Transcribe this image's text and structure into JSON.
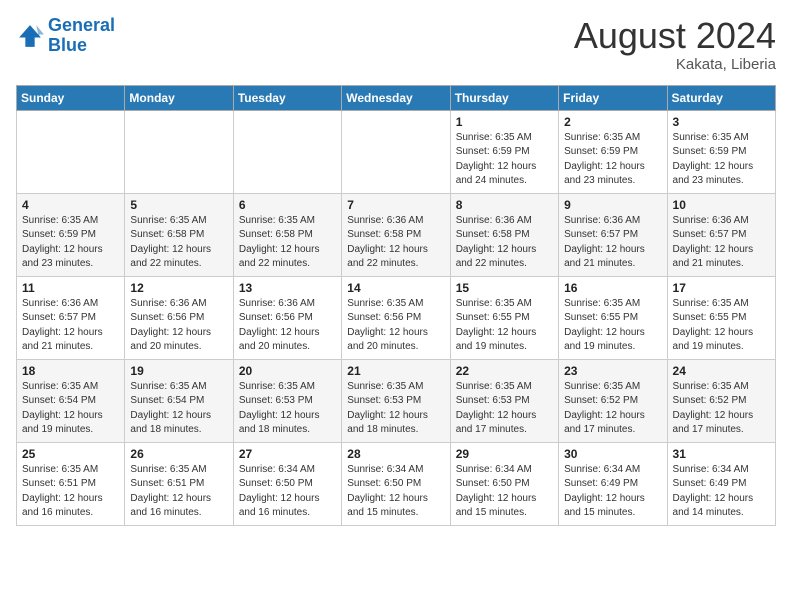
{
  "logo": {
    "line1": "General",
    "line2": "Blue"
  },
  "title": "August 2024",
  "location": "Kakata, Liberia",
  "weekdays": [
    "Sunday",
    "Monday",
    "Tuesday",
    "Wednesday",
    "Thursday",
    "Friday",
    "Saturday"
  ],
  "weeks": [
    [
      {
        "day": "",
        "detail": ""
      },
      {
        "day": "",
        "detail": ""
      },
      {
        "day": "",
        "detail": ""
      },
      {
        "day": "",
        "detail": ""
      },
      {
        "day": "1",
        "detail": "Sunrise: 6:35 AM\nSunset: 6:59 PM\nDaylight: 12 hours\nand 24 minutes."
      },
      {
        "day": "2",
        "detail": "Sunrise: 6:35 AM\nSunset: 6:59 PM\nDaylight: 12 hours\nand 23 minutes."
      },
      {
        "day": "3",
        "detail": "Sunrise: 6:35 AM\nSunset: 6:59 PM\nDaylight: 12 hours\nand 23 minutes."
      }
    ],
    [
      {
        "day": "4",
        "detail": "Sunrise: 6:35 AM\nSunset: 6:59 PM\nDaylight: 12 hours\nand 23 minutes."
      },
      {
        "day": "5",
        "detail": "Sunrise: 6:35 AM\nSunset: 6:58 PM\nDaylight: 12 hours\nand 22 minutes."
      },
      {
        "day": "6",
        "detail": "Sunrise: 6:35 AM\nSunset: 6:58 PM\nDaylight: 12 hours\nand 22 minutes."
      },
      {
        "day": "7",
        "detail": "Sunrise: 6:36 AM\nSunset: 6:58 PM\nDaylight: 12 hours\nand 22 minutes."
      },
      {
        "day": "8",
        "detail": "Sunrise: 6:36 AM\nSunset: 6:58 PM\nDaylight: 12 hours\nand 22 minutes."
      },
      {
        "day": "9",
        "detail": "Sunrise: 6:36 AM\nSunset: 6:57 PM\nDaylight: 12 hours\nand 21 minutes."
      },
      {
        "day": "10",
        "detail": "Sunrise: 6:36 AM\nSunset: 6:57 PM\nDaylight: 12 hours\nand 21 minutes."
      }
    ],
    [
      {
        "day": "11",
        "detail": "Sunrise: 6:36 AM\nSunset: 6:57 PM\nDaylight: 12 hours\nand 21 minutes."
      },
      {
        "day": "12",
        "detail": "Sunrise: 6:36 AM\nSunset: 6:56 PM\nDaylight: 12 hours\nand 20 minutes."
      },
      {
        "day": "13",
        "detail": "Sunrise: 6:36 AM\nSunset: 6:56 PM\nDaylight: 12 hours\nand 20 minutes."
      },
      {
        "day": "14",
        "detail": "Sunrise: 6:35 AM\nSunset: 6:56 PM\nDaylight: 12 hours\nand 20 minutes."
      },
      {
        "day": "15",
        "detail": "Sunrise: 6:35 AM\nSunset: 6:55 PM\nDaylight: 12 hours\nand 19 minutes."
      },
      {
        "day": "16",
        "detail": "Sunrise: 6:35 AM\nSunset: 6:55 PM\nDaylight: 12 hours\nand 19 minutes."
      },
      {
        "day": "17",
        "detail": "Sunrise: 6:35 AM\nSunset: 6:55 PM\nDaylight: 12 hours\nand 19 minutes."
      }
    ],
    [
      {
        "day": "18",
        "detail": "Sunrise: 6:35 AM\nSunset: 6:54 PM\nDaylight: 12 hours\nand 19 minutes."
      },
      {
        "day": "19",
        "detail": "Sunrise: 6:35 AM\nSunset: 6:54 PM\nDaylight: 12 hours\nand 18 minutes."
      },
      {
        "day": "20",
        "detail": "Sunrise: 6:35 AM\nSunset: 6:53 PM\nDaylight: 12 hours\nand 18 minutes."
      },
      {
        "day": "21",
        "detail": "Sunrise: 6:35 AM\nSunset: 6:53 PM\nDaylight: 12 hours\nand 18 minutes."
      },
      {
        "day": "22",
        "detail": "Sunrise: 6:35 AM\nSunset: 6:53 PM\nDaylight: 12 hours\nand 17 minutes."
      },
      {
        "day": "23",
        "detail": "Sunrise: 6:35 AM\nSunset: 6:52 PM\nDaylight: 12 hours\nand 17 minutes."
      },
      {
        "day": "24",
        "detail": "Sunrise: 6:35 AM\nSunset: 6:52 PM\nDaylight: 12 hours\nand 17 minutes."
      }
    ],
    [
      {
        "day": "25",
        "detail": "Sunrise: 6:35 AM\nSunset: 6:51 PM\nDaylight: 12 hours\nand 16 minutes."
      },
      {
        "day": "26",
        "detail": "Sunrise: 6:35 AM\nSunset: 6:51 PM\nDaylight: 12 hours\nand 16 minutes."
      },
      {
        "day": "27",
        "detail": "Sunrise: 6:34 AM\nSunset: 6:50 PM\nDaylight: 12 hours\nand 16 minutes."
      },
      {
        "day": "28",
        "detail": "Sunrise: 6:34 AM\nSunset: 6:50 PM\nDaylight: 12 hours\nand 15 minutes."
      },
      {
        "day": "29",
        "detail": "Sunrise: 6:34 AM\nSunset: 6:50 PM\nDaylight: 12 hours\nand 15 minutes."
      },
      {
        "day": "30",
        "detail": "Sunrise: 6:34 AM\nSunset: 6:49 PM\nDaylight: 12 hours\nand 15 minutes."
      },
      {
        "day": "31",
        "detail": "Sunrise: 6:34 AM\nSunset: 6:49 PM\nDaylight: 12 hours\nand 14 minutes."
      }
    ]
  ]
}
